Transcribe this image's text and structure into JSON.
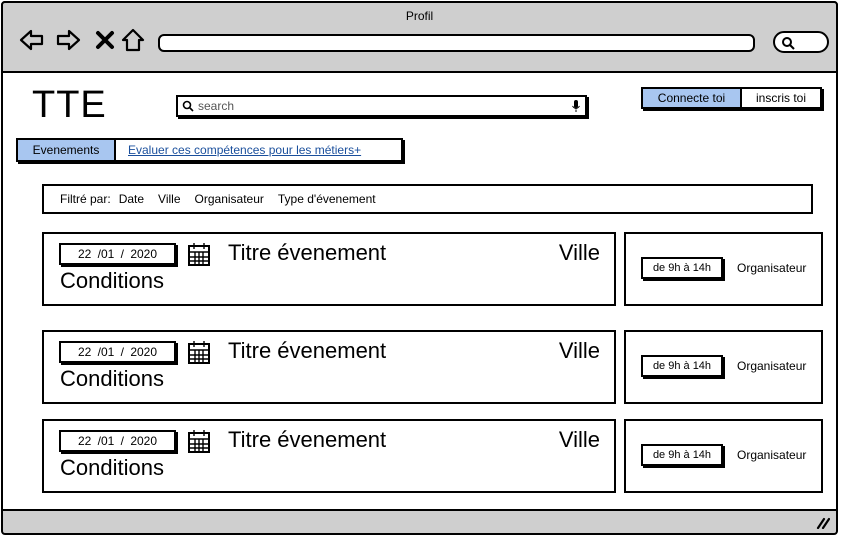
{
  "window": {
    "title": "Profil"
  },
  "browser": {
    "back_icon": "back-arrow-icon",
    "forward_icon": "forward-arrow-icon",
    "close_icon": "close-x-icon",
    "home_icon": "home-icon",
    "address_value": ""
  },
  "header": {
    "logo": "TTE",
    "search_placeholder": "search",
    "login_label": "Connecte toi",
    "signup_label": "inscris toi"
  },
  "tabs": [
    {
      "label": "Evenements",
      "active": true
    },
    {
      "label": "Evaluer ces compétences pour les métiers+",
      "active": false
    }
  ],
  "filters": {
    "label": "Filtré par:",
    "items": [
      "Date",
      "Ville",
      "Organisateur",
      "Type d'évenement"
    ]
  },
  "events": [
    {
      "date": "22 /01 / 2020",
      "title": "Titre évenement",
      "city": "Ville",
      "conditions": "Conditions",
      "hours": "de 9h à 14h",
      "organizer": "Organisateur"
    },
    {
      "date": "22 /01 / 2020",
      "title": "Titre évenement",
      "city": "Ville",
      "conditions": "Conditions",
      "hours": "de 9h à 14h",
      "organizer": "Organisateur"
    },
    {
      "date": "22 /01 / 2020",
      "title": "Titre évenement",
      "city": "Ville",
      "conditions": "Conditions",
      "hours": "de 9h à 14h",
      "organizer": "Organisateur"
    }
  ],
  "colors": {
    "accent": "#a8c6f0",
    "chrome": "#cfcfcf",
    "link": "#1a4f9c"
  }
}
